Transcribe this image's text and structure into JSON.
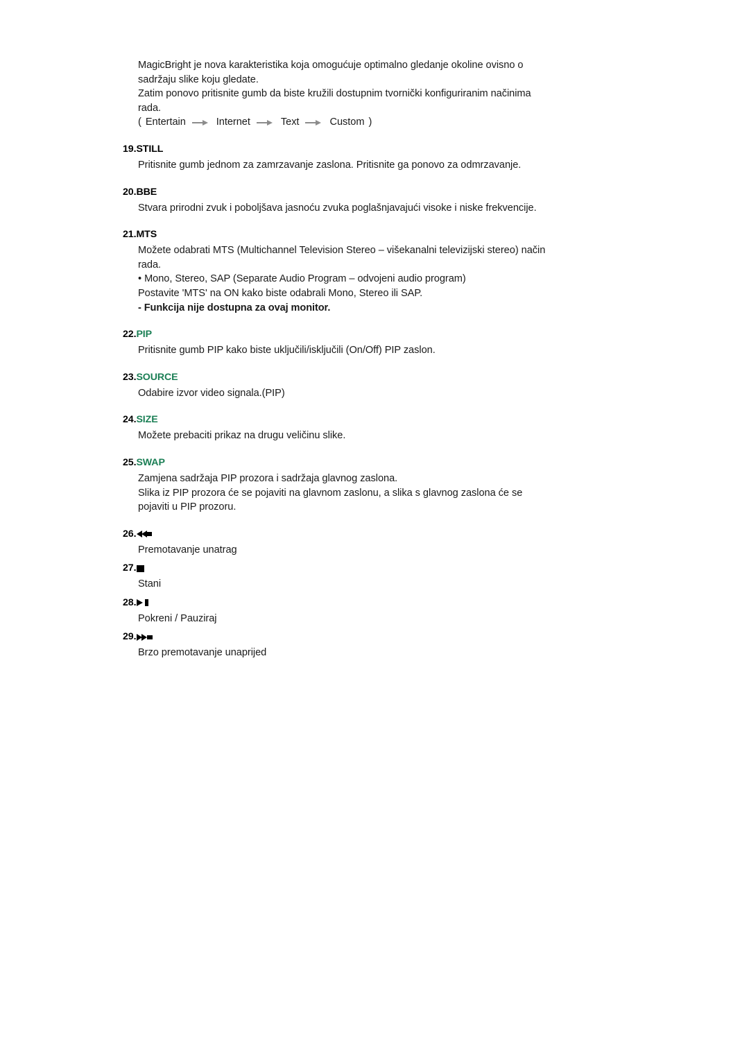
{
  "document": {
    "language": "hr",
    "intro": {
      "lines": [
        "MagicBright je nova karakteristika koja omogućuje optimalno gledanje okoline ovisno o",
        "sadržaju slike koju gledate.",
        "Zatim ponovo pritisnite gumb da biste kružili dostupnim tvornički konfiguriranim načinima",
        "rada."
      ],
      "flow": {
        "open_paren": "(",
        "steps": [
          "Entertain",
          "Internet",
          "Text",
          "Custom"
        ],
        "close_paren": ")",
        "arrow_icon": "arrow-right-icon",
        "arrow_color": "#8c8c8c"
      }
    },
    "heading_green": "#1b7f55",
    "sections": [
      {
        "number": "19.",
        "title": "STILL",
        "title_green": false,
        "lines": [
          {
            "text": "Pritisnite gumb jednom za zamrzavanje zaslona. Pritisnite ga ponovo za odmrzavanje.",
            "bold": false
          }
        ]
      },
      {
        "number": "20.",
        "title": "BBE",
        "title_green": false,
        "lines": [
          {
            "text": "Stvara prirodni zvuk i poboljšava jasnoću zvuka poglašnjavajući visoke i niske frekvencije.",
            "bold": false
          }
        ]
      },
      {
        "number": "21.",
        "title": "MTS",
        "title_green": false,
        "lines": [
          {
            "text": "Možete odabrati MTS (Multichannel Television Stereo – višekanalni televizijski stereo) način",
            "bold": false
          },
          {
            "text": "rada.",
            "bold": false
          },
          {
            "text": "• Mono, Stereo, SAP (Separate Audio Program – odvojeni audio program)",
            "bold": false
          },
          {
            "text": "Postavite 'MTS' na ON kako biste odabrali Mono, Stereo ili SAP.",
            "bold": false
          },
          {
            "text": "- Funkcija nije dostupna za ovaj monitor.",
            "bold": true
          }
        ]
      },
      {
        "number": "22.",
        "title": "PIP",
        "title_green": true,
        "lines": [
          {
            "text": "Pritisnite gumb PIP kako biste uključili/isključili (On/Off) PIP zaslon.",
            "bold": false
          }
        ]
      },
      {
        "number": "23.",
        "title": "SOURCE",
        "title_green": true,
        "lines": [
          {
            "text": "Odabire izvor video signala.(PIP)",
            "bold": false
          }
        ]
      },
      {
        "number": "24.",
        "title": "SIZE",
        "title_green": true,
        "lines": [
          {
            "text": "Možete prebaciti prikaz na drugu veličinu slike.",
            "bold": false
          }
        ]
      },
      {
        "number": "25.",
        "title": "SWAP",
        "title_green": true,
        "lines": [
          {
            "text": "Zamjena sadržaja PIP prozora i sadržaja glavnog zaslona.",
            "bold": false
          },
          {
            "text": "Slika iz PIP prozora će se pojaviti na glavnom zaslonu, a slika s glavnog zaslona će se",
            "bold": false
          },
          {
            "text": "pojaviti u PIP prozoru.",
            "bold": false
          }
        ]
      }
    ],
    "transport_sections": [
      {
        "number": "26.",
        "icon": "rewind-icon",
        "lines": [
          {
            "text": "Premotavanje unatrag",
            "bold": false
          }
        ]
      },
      {
        "number": "27.",
        "icon": "stop-icon",
        "lines": [
          {
            "text": "Stani",
            "bold": false
          }
        ]
      },
      {
        "number": "28.",
        "icon": "play-pause-icon",
        "lines": [
          {
            "text": "Pokreni / Pauziraj",
            "bold": false
          }
        ]
      },
      {
        "number": "29.",
        "icon": "fast-forward-icon",
        "lines": [
          {
            "text": "Brzo premotavanje unaprijed",
            "bold": false
          }
        ]
      }
    ]
  }
}
